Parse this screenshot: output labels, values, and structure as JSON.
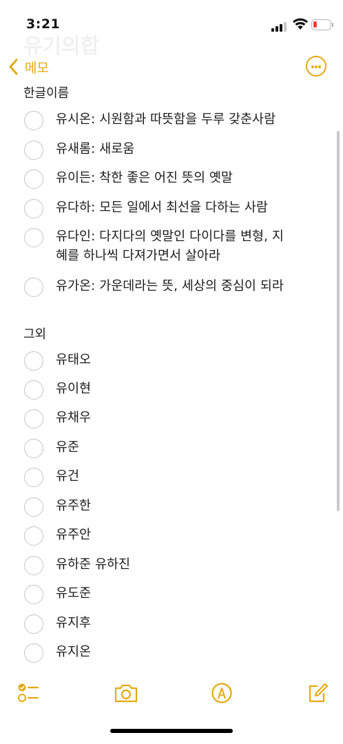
{
  "status_bar": {
    "time": "3:21"
  },
  "nav": {
    "back_label": "메모",
    "ghost_title": "유기의합"
  },
  "colors": {
    "accent": "#e3a90d",
    "battery_low": "#ff3b30"
  },
  "sections": [
    {
      "header": "한글이름",
      "items": [
        "유시온: 시원함과 따뜻함을 두루 갖춘사람",
        "유새롬: 새로움",
        "유이든: 착한 좋은 어진 뜻의 옛말",
        "유다하: 모든 일에서 최선을 다하는 사람",
        "유다인: 다지다의 옛말인 다이다를 변형, 지\n혜를 하나씩 다져가면서 살아라",
        "유가온: 가운데라는 뜻, 세상의 중심이 되라"
      ]
    },
    {
      "header": "그외",
      "items": [
        "유태오",
        "유이현",
        "유채우",
        "유준",
        "유건",
        "유주한",
        "유주안",
        "유하준 유하진",
        "유도준",
        "유지후",
        "유지온"
      ]
    }
  ],
  "toolbar": {
    "icons": [
      "checklist-icon",
      "camera-icon",
      "markup-icon",
      "compose-icon"
    ]
  }
}
